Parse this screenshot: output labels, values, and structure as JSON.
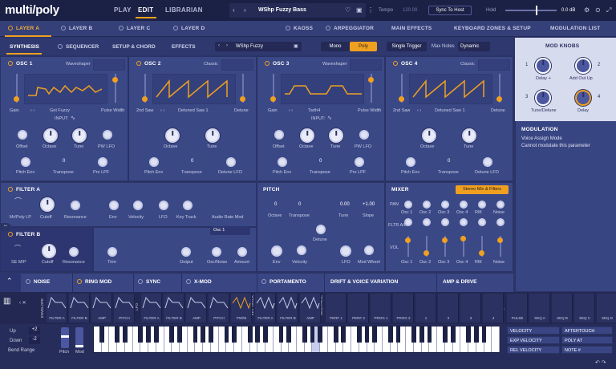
{
  "app": {
    "logo": "multi/poly"
  },
  "topnav": {
    "play": "PLAY",
    "edit": "EDIT",
    "librarian": "LIBRARIAN"
  },
  "preset": {
    "name": "WShp Fuzzy Bass"
  },
  "transport": {
    "tempo_label": "Tempo",
    "tempo_value": "120.00",
    "sync": "Sync To Host",
    "hold": "Hold",
    "volume": "0.0 dB"
  },
  "layers": [
    "LAYER A",
    "LAYER B",
    "LAYER C",
    "LAYER D"
  ],
  "layer_tabs": {
    "kaoss": "KAOSS",
    "arpeggiator": "ARPEGGIATOR",
    "main_effects": "MAIN EFFECTS",
    "keyboard_zones": "KEYBOARD ZONES & SETUP",
    "mod_list": "MODULATION LIST"
  },
  "subtabs": {
    "synthesis": "SYNTHESIS",
    "sequencer": "SEQUENCER",
    "setup": "SETUP & CHORD",
    "effects": "EFFECTS"
  },
  "osc_preset": "WShp Fuzzy",
  "voice": {
    "mono": "Mono",
    "poly": "Poly",
    "single_trigger": "Single Trigger",
    "max_notes": "Max Notes",
    "dynamic": "Dynamic"
  },
  "osc1": {
    "title": "OSC 1",
    "mode": "Waveshaper",
    "gain": "Gain",
    "shape": "Get Fuzzy",
    "pulse": "Pulse Width",
    "input": "INPUT:",
    "offset": "Offset",
    "octave": "Octave",
    "tune": "Tune",
    "pwlfo": "PW LFO",
    "pitchenv": "Pitch Env",
    "transpose": "Transpose",
    "transpose_val": "0",
    "prelpf": "Pre LPF"
  },
  "osc2": {
    "title": "OSC 2",
    "mode": "Classic",
    "saw": "2nd Saw",
    "shape": "Detuned Saw 1",
    "detune": "Detune",
    "octave": "Octave",
    "tune": "Tune",
    "pitchenv": "Pitch Env",
    "transpose": "Transpose",
    "transpose_val": "0",
    "detunelfo": "Detune LFO"
  },
  "osc3": {
    "title": "OSC 3",
    "mode": "Waveshaper",
    "gain": "Gain",
    "shape": "Tarth4",
    "pulse": "Pulse Width",
    "input": "INPUT:",
    "offset": "Offset",
    "octave": "Octave",
    "tune": "Tune",
    "pwlfo": "PW LFO",
    "pitchenv": "Pitch Env",
    "transpose": "Transpose",
    "transpose_val": "0",
    "prelpf": "Pre LPF"
  },
  "osc4": {
    "title": "OSC 4",
    "mode": "Classic",
    "saw": "2nd Saw",
    "shape": "Detuned Saw 1",
    "detune": "Detune",
    "octave": "Octave",
    "tune": "Tune",
    "pitchenv": "Pitch Env",
    "transpose": "Transpose",
    "transpose_val": "0",
    "detunelfo": "Detune LFO"
  },
  "filter_a": {
    "title": "FILTER A",
    "type": "Mr/Poly LP",
    "cutoff": "Cutoff",
    "resonance": "Resonance",
    "env": "Env",
    "velocity": "Velocity",
    "lfo": "LFO",
    "keytrack": "Key Track",
    "audiorate": "Audio Rate Mod",
    "source": "Osc 1"
  },
  "filter_b": {
    "title": "FILTER B",
    "type": "SE M/P",
    "cutoff": "Cutoff",
    "resonance": "Resonance",
    "trim": "Trim",
    "output": "Output",
    "oscnoise": "Osc/Noise",
    "amount": "Amount"
  },
  "pitch": {
    "title": "PITCH",
    "octave": "Octave",
    "octave_val": "0",
    "transpose": "Transpose",
    "transpose_val": "0",
    "tune": "Tune",
    "tune_val": "0.00",
    "slope": "Slope",
    "slope_val": "+1.00",
    "detune": "Detune",
    "env": "Env",
    "velocity": "Velocity",
    "lfo": "LFO",
    "modwheel": "Mod Wheel"
  },
  "mixer": {
    "title": "MIXER",
    "route": "Stereo Mix & Filters",
    "pan": "PAN",
    "fltr": "FLTR A/B",
    "vol": "VOL",
    "channels": [
      "Osc 1",
      "Osc 2",
      "Osc 3",
      "Osc 4",
      "RM",
      "Noise"
    ]
  },
  "mod_knobs": {
    "title": "MOD KNOBS",
    "k1": "1",
    "k2": "2",
    "k3": "3",
    "k4": "4",
    "l1": "Delay +",
    "l2": "Add Out Up",
    "l3": "Tune/Detune",
    "l4": "Delay"
  },
  "modulation": {
    "title": "MODULATION",
    "line1": "Voice Assign Mode",
    "line2": "Cannot modulate this parameter"
  },
  "sections": {
    "noise": "NOISE",
    "ringmod": "RING MOD",
    "sync": "SYNC",
    "xmod": "X-MOD",
    "portamento": "PORTAMENTO",
    "drift": "DRIFT & VOICE VARIATION",
    "amp": "AMP & DRIVE"
  },
  "mod_slots": [
    "FILTER A",
    "FILTER B",
    "AMP",
    "PITCH",
    "FILTER A",
    "FILTER B",
    "AMP",
    "PITCH",
    "PW/M",
    "FILTER A",
    "FILTER B",
    "AMP",
    "PERF 1",
    "PERF 2",
    "PROG 1",
    "PROG 2",
    "1",
    "2",
    "3",
    "4",
    "PULSE",
    "SEQ A",
    "SEQ B",
    "SEQ C",
    "SEQ D"
  ],
  "strip_groups": {
    "envelope": "ENVELOPE",
    "lfo": "LFO",
    "keytrack": "KEY TRACK",
    "modproc": "MOD PROC",
    "sequence": "SEQUENCE"
  },
  "bottom": {
    "up": "Up",
    "up_val": "+2",
    "down": "Down",
    "down_val": "-2",
    "bend": "Bend Range",
    "pitch": "Pitch",
    "mod": "Mod",
    "velocity": "VELOCITY",
    "exp_velocity": "EXP VELOCITY",
    "rel_velocity": "REL VELOCITY",
    "aftertouch": "AFTERTOUCH",
    "poly_at": "POLY AT",
    "note": "NOTE #"
  },
  "colors": {
    "accent": "#f0a020",
    "panel": "#3b4886",
    "background": "#2c3566"
  }
}
